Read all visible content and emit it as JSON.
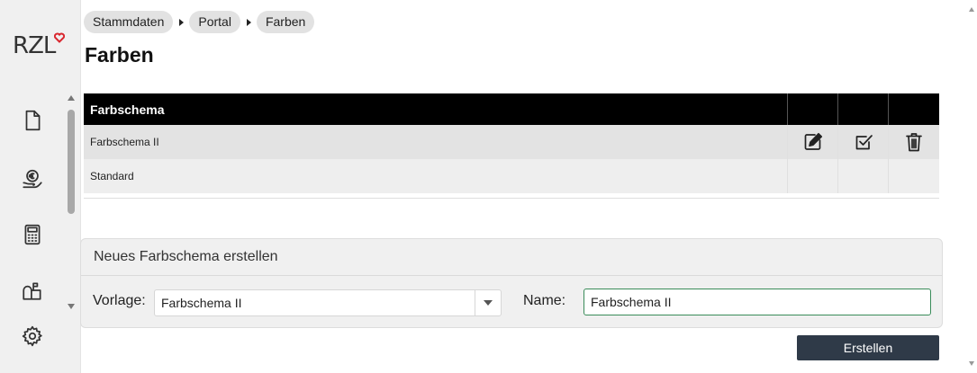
{
  "logo": {
    "text": "RZL"
  },
  "sidebar": {
    "icons": [
      "document-icon",
      "euro-hand-icon",
      "calculator-icon",
      "mailbox-icon",
      "gear-icon"
    ]
  },
  "breadcrumb": [
    "Stammdaten",
    "Portal",
    "Farben"
  ],
  "page": {
    "title": "Farben"
  },
  "table": {
    "header": "Farbschema",
    "rows": [
      {
        "name": "Farbschema II",
        "selected": true
      },
      {
        "name": "Standard",
        "selected": false
      }
    ],
    "action_icons": [
      "edit-icon",
      "check-icon",
      "trash-icon"
    ]
  },
  "create_panel": {
    "title": "Neues Farbschema erstellen",
    "template_label": "Vorlage:",
    "template_value": "Farbschema II",
    "name_label": "Name:",
    "name_value": "Farbschema II",
    "submit_label": "Erstellen"
  },
  "colors": {
    "accent": "#d9262e",
    "button": "#2f3a48",
    "table_header": "#000000",
    "input_border_active": "#3a8c5a"
  }
}
